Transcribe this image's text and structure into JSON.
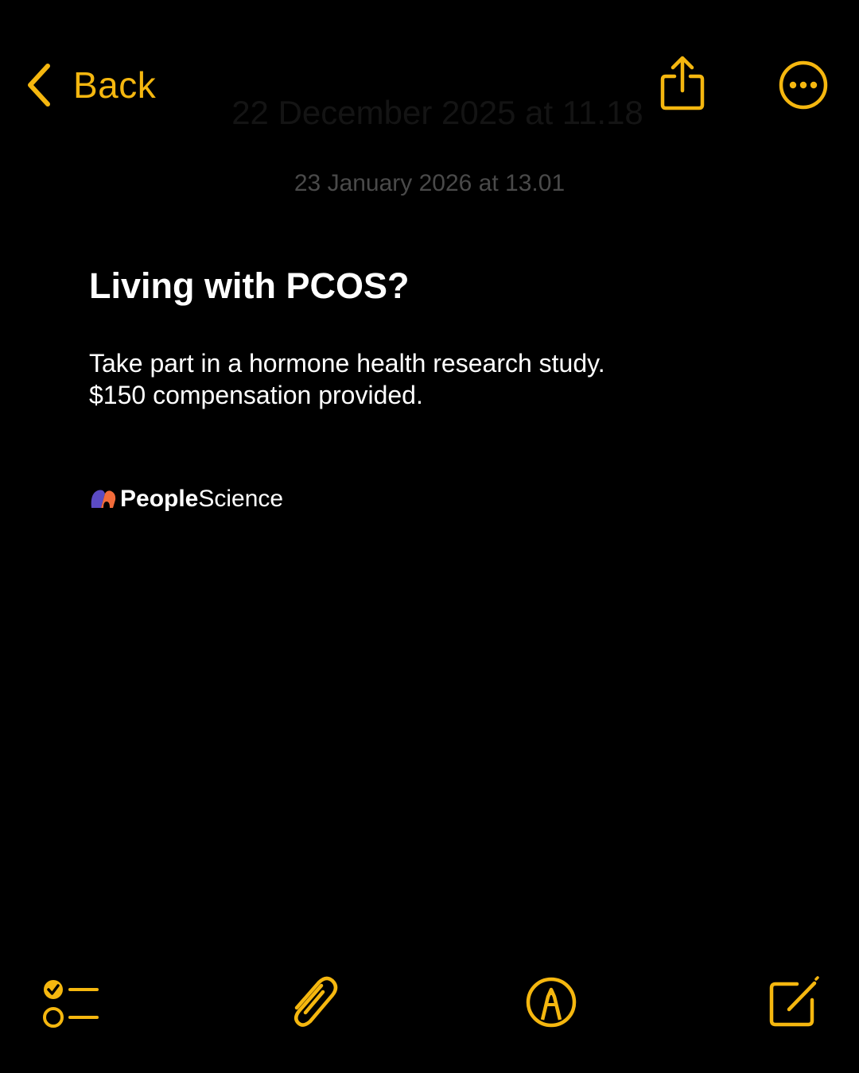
{
  "colors": {
    "accent": "#F5B70F",
    "background": "#000000",
    "text": "#FFFFFF",
    "muted": "#4A4A4A",
    "brand_purple": "#5B4BC4",
    "brand_orange": "#F26B3A"
  },
  "nav": {
    "back_label": "Back",
    "back_icon": "chevron-left-icon",
    "share_icon": "share-icon",
    "more_icon": "ellipsis-circle-icon",
    "ghost_date": "22 December 2025 at 11.18"
  },
  "note": {
    "date": "23 January 2026 at 13.01",
    "title": "Living with PCOS?",
    "body_lines": [
      "Take part in a hormone health research study.",
      "$150 compensation provided."
    ],
    "brand": {
      "bold": "People",
      "light": "Science"
    }
  },
  "toolbar": {
    "checklist_icon": "checklist-icon",
    "attachment_icon": "paperclip-icon",
    "markup_icon": "markup-pen-icon",
    "compose_icon": "compose-icon"
  }
}
